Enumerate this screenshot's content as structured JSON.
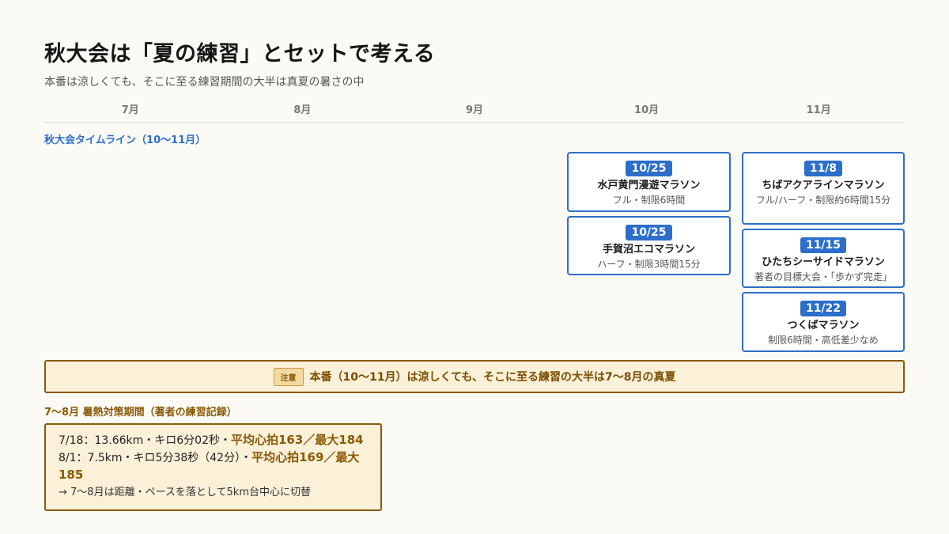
{
  "header": {
    "title": "秋大会は「夏の練習」とセットで考える",
    "subtitle": "本番は涼しくても、そこに至る練習期間の大半は真夏の暑さの中"
  },
  "timeline": {
    "months": [
      "7月",
      "8月",
      "9月",
      "10月",
      "11月"
    ],
    "section_label": "秋大会タイムライン（10〜11月）",
    "events": [
      {
        "date": "10/25",
        "name": "水戸黄門漫遊マラソン",
        "desc": "フル・制限6時間"
      },
      {
        "date": "10/25",
        "name": "手賀沼エコマラソン",
        "desc": "ハーフ・制限3時間15分"
      },
      {
        "date": "11/8",
        "name": "ちばアクアラインマラソン",
        "desc": "フル/ハーフ・制限約6時間15分"
      },
      {
        "date": "11/15",
        "name": "ひたちシーサイドマラソン",
        "desc": "著者の目標大会・「歩かず完走」"
      },
      {
        "date": "11/22",
        "name": "つくばマラソン",
        "desc": "制限6時間・高低差少なめ"
      }
    ]
  },
  "notice": {
    "badge": "注意",
    "text": "本番（10〜11月）は涼しくても、そこに至る練習の大半は7〜8月の真夏"
  },
  "records": {
    "label": "7〜8月 暑熱対策期間（著者の練習記録）",
    "entries": [
      {
        "main": "7/18：13.66km・キロ6分02秒・",
        "hr": "平均心拍163／最大184"
      },
      {
        "main": "8/1：7.5km・キロ5分38秒（42分）・",
        "hr": "平均心拍169／最大185"
      }
    ],
    "note": "→ 7〜8月は距離・ペースを落として5km台中心に切替"
  },
  "colors": {
    "accent_blue": "#2c6ec9",
    "warn_brown": "#8a5a07",
    "warn_bg": "#fbf0d8",
    "page_bg": "#fbfaf5"
  }
}
